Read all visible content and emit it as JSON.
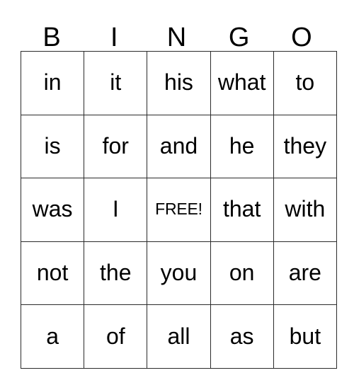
{
  "card": {
    "title": "BINGO",
    "headers": [
      "B",
      "I",
      "N",
      "G",
      "O"
    ],
    "free_space": {
      "label": "FREE!",
      "row": 2,
      "column": 2
    },
    "rows": [
      {
        "cells": [
          "in",
          "it",
          "his",
          "what",
          "to"
        ]
      },
      {
        "cells": [
          "is",
          "for",
          "and",
          "he",
          "they"
        ]
      },
      {
        "cells": [
          "was",
          "I",
          "FREE!",
          "that",
          "with"
        ]
      },
      {
        "cells": [
          "not",
          "the",
          "you",
          "on",
          "are"
        ]
      },
      {
        "cells": [
          "a",
          "of",
          "all",
          "as",
          "but"
        ]
      }
    ],
    "colors": {
      "background": "#ffffff",
      "border": "#2b2b2b",
      "text": "#000000"
    }
  }
}
